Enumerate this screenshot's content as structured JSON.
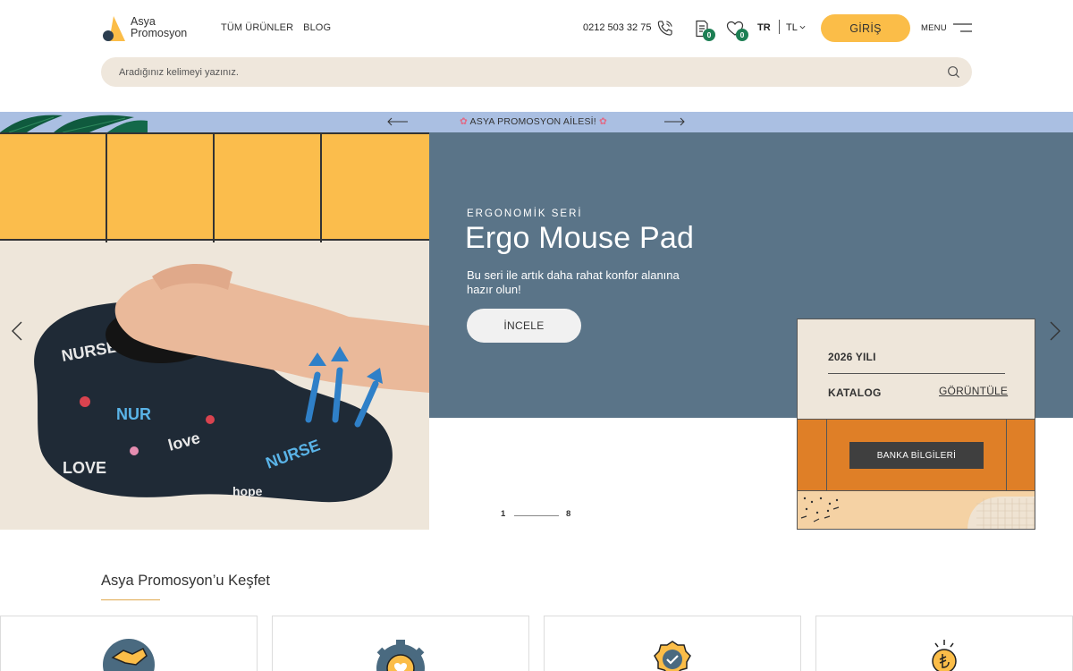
{
  "brand": {
    "line1": "Asya",
    "line2": "Promosyon",
    "colors": {
      "accent": "#fbbd48",
      "badge": "#1d7f54",
      "hero_panel": "#5a7488"
    }
  },
  "nav": {
    "items": [
      "TÜM ÜRÜNLER",
      "BLOG"
    ]
  },
  "header": {
    "phone": "0212 503 32 75",
    "quote_count": "0",
    "favorites_count": "0",
    "language": "TR",
    "currency": "TL",
    "login_label": "GİRİŞ",
    "menu_label": "MENU"
  },
  "search": {
    "placeholder": "Aradığınız kelimeyi yazınız."
  },
  "announcement": {
    "text": "ASYA PROMOSYON AİLESİ!"
  },
  "hero": {
    "eyebrow": "ERGONOMİK SERİ",
    "title": "Ergo Mouse Pad",
    "description": "Bu seri ile artık daha rahat konfor alanına hazır olun!",
    "cta_label": "İNCELE",
    "pager_current": "1",
    "pager_total": "8"
  },
  "catalog": {
    "year": "2026 YILI",
    "label": "KATALOG",
    "link": "GÖRÜNTÜLE",
    "bank_label": "BANKA BİLGİLERİ"
  },
  "discover": {
    "title": "Asya Promosyon’u Keşfet",
    "cards": [
      {
        "icon": "handshake-icon"
      },
      {
        "icon": "gear-heart-icon"
      },
      {
        "icon": "quality-badge-icon"
      },
      {
        "icon": "coin-icon"
      }
    ]
  }
}
